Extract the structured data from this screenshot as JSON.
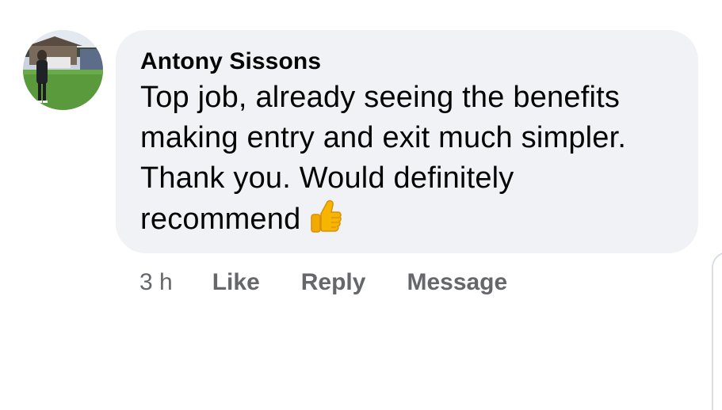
{
  "comment": {
    "author": "Antony Sissons",
    "text": "Top job, already seeing the benefits\nmaking entry and exit much simpler.\nThank you. Would definitely\nrecommend",
    "emoji": "thumbs-up-icon",
    "time": "3 h",
    "actions": {
      "like": "Like",
      "reply": "Reply",
      "message": "Message"
    }
  },
  "colors": {
    "bubble_bg": "#f0f2f5",
    "text": "#050505",
    "meta": "#65676b"
  }
}
